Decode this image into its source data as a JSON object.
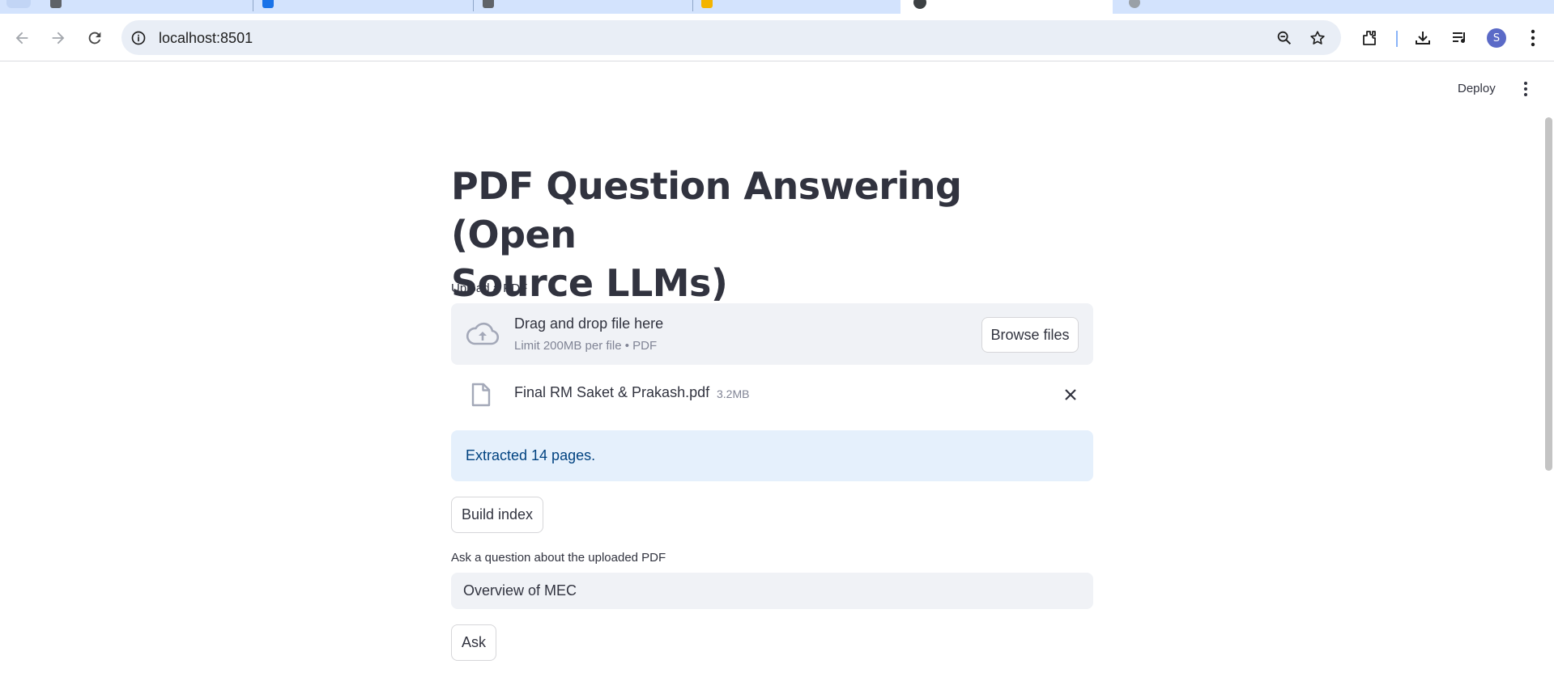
{
  "browser": {
    "url": "localhost:8501",
    "avatar_letter": "S"
  },
  "app": {
    "deploy_label": "Deploy",
    "title_line1": "PDF Question Answering (Open",
    "title_line2": "Source LLMs)",
    "upload": {
      "label": "Upload a PDF",
      "drop_text": "Drag and drop file here",
      "limit_text": "Limit 200MB per file • PDF",
      "browse_label": "Browse files"
    },
    "file": {
      "name": "Final RM Saket & Prakash.pdf",
      "size": "3.2MB"
    },
    "status": {
      "message": "Extracted 14 pages."
    },
    "build_index_label": "Build index",
    "question": {
      "label": "Ask a question about the uploaded PDF",
      "value": "Overview of MEC"
    },
    "ask_label": "Ask"
  },
  "colors": {
    "tabstrip": "#d3e3fd",
    "omnibox": "#e9eef6",
    "text": "#31333f",
    "muted": "#808495",
    "info_bg": "#e5f0fc",
    "info_text": "#004280",
    "input_bg": "#f0f2f6"
  }
}
